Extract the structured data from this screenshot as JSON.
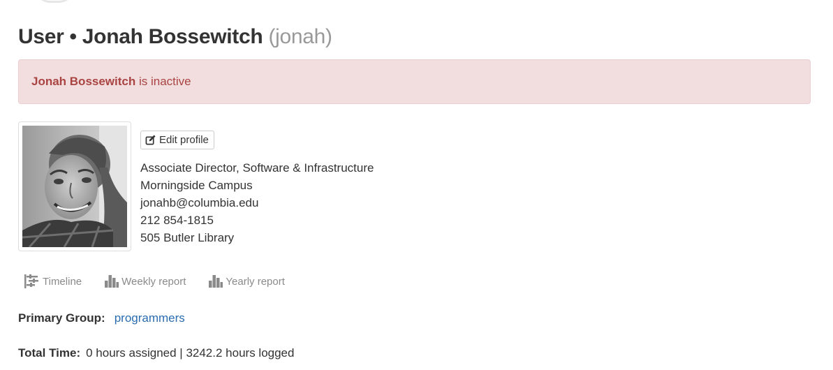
{
  "header": {
    "title_prefix": "User • Jonah Bossewitch",
    "username": "(jonah)"
  },
  "alert": {
    "name": "Jonah Bossewitch",
    "text": " is inactive"
  },
  "profile": {
    "edit_label": "Edit profile",
    "title": "Associate Director, Software & Infrastructure",
    "campus": "Morningside Campus",
    "email": "jonahb@columbia.edu",
    "phone": "212 854-1815",
    "office": "505 Butler Library"
  },
  "reports": [
    {
      "label": "Timeline",
      "icon": "timeline-icon"
    },
    {
      "label": "Weekly report",
      "icon": "bar-chart-icon"
    },
    {
      "label": "Yearly report",
      "icon": "bar-chart-icon"
    }
  ],
  "primary_group": {
    "label": "Primary Group:",
    "value": "programmers"
  },
  "total_time": {
    "label": "Total Time:",
    "value": "0 hours assigned | 3242.2 hours logged"
  },
  "colors": {
    "alert_bg": "#f2dede",
    "alert_text": "#a94442",
    "link": "#2a6cb0",
    "muted": "#999999"
  }
}
